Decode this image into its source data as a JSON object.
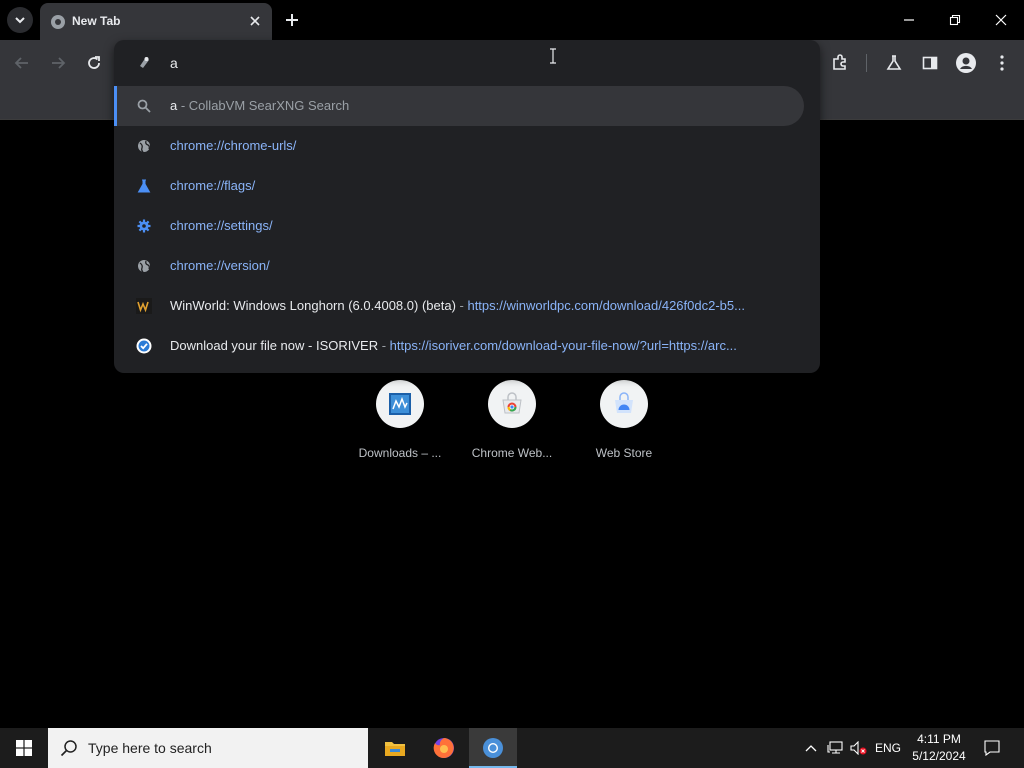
{
  "tab": {
    "title": "New Tab"
  },
  "omnibox": {
    "input_value": "a",
    "suggestions": [
      {
        "icon": "search-icon",
        "main": "a",
        "sep": " - ",
        "detail": "CollabVM SearXNG Search",
        "kind": "search"
      },
      {
        "icon": "globe-icon",
        "main": "chrome://chrome-urls/",
        "kind": "url"
      },
      {
        "icon": "flask-icon",
        "main": "chrome://flags/",
        "kind": "url"
      },
      {
        "icon": "gear-icon",
        "main": "chrome://settings/",
        "kind": "url"
      },
      {
        "icon": "globe-icon",
        "main": "chrome://version/",
        "kind": "url"
      },
      {
        "icon": "winworld-icon",
        "main": "WinWorld: Windows Longhorn (6.0.4008.0) (beta)",
        "sep": " - ",
        "detail": "https://winworldpc.com/download/426f0dc2-b5...",
        "kind": "history"
      },
      {
        "icon": "isoriver-icon",
        "main": "Download your file now - ISORIVER",
        "sep": " - ",
        "detail": "https://isoriver.com/download-your-file-now/?url=https://arc...",
        "kind": "history"
      }
    ]
  },
  "shortcuts": [
    {
      "label": "Downloads – ...",
      "icon": "downloads-site-icon"
    },
    {
      "label": "Chrome Web...",
      "icon": "chrome-web-store-icon"
    },
    {
      "label": "Web Store",
      "icon": "web-store-icon"
    }
  ],
  "taskbar": {
    "search_placeholder": "Type here to search",
    "language": "ENG",
    "time": "4:11 PM",
    "date": "5/12/2024"
  },
  "colors": {
    "accent": "#4b8ff5",
    "url": "#8ab4f8",
    "toolbar": "#35363a",
    "dropdown": "#202124"
  }
}
